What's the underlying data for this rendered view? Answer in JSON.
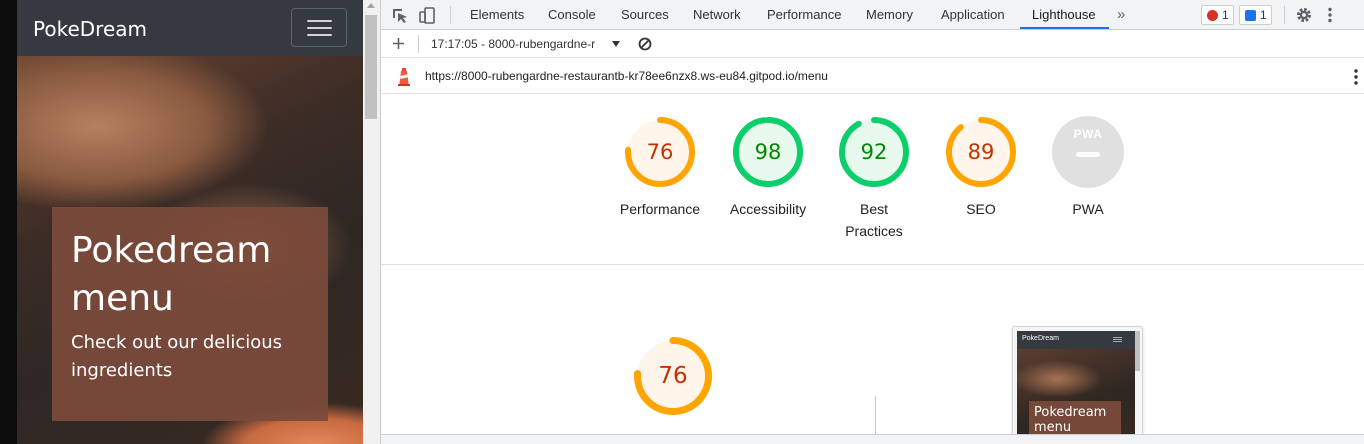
{
  "site": {
    "brand": "PokeDream",
    "hero_title": "Pokedream menu",
    "hero_subtitle": "Check out our delicious ingredients"
  },
  "devtools": {
    "tabs": [
      "Elements",
      "Console",
      "Sources",
      "Network",
      "Performance",
      "Memory",
      "Application",
      "Lighthouse"
    ],
    "active_tab": "Lighthouse",
    "more_tabs": "»",
    "error_count": "1",
    "message_count": "1",
    "report_selector": "17:17:05 - 8000-rubengardne-r",
    "url": "https://8000-rubengardne-restaurantb-kr78ee6nzx8.ws-eu84.gitpod.io/menu"
  },
  "scores": [
    {
      "label": "Performance",
      "value": "76",
      "fraction": 0.76,
      "status": "average"
    },
    {
      "label": "Accessibility",
      "value": "98",
      "fraction": 0.98,
      "status": "pass"
    },
    {
      "label": "Best Practices",
      "value": "92",
      "fraction": 0.92,
      "status": "pass"
    },
    {
      "label": "SEO",
      "value": "89",
      "fraction": 0.89,
      "status": "average"
    },
    {
      "label": "PWA",
      "value": "PWA",
      "fraction": 0,
      "status": "na"
    }
  ],
  "performance_detail": {
    "value": "76",
    "fraction": 0.76
  },
  "thumbnail": {
    "brand": "PokeDream",
    "title": "Pokedream menu"
  },
  "colors": {
    "pass": "#0cce6b",
    "pass_text": "#008800",
    "pass_fill": "#e7f9ed",
    "average": "#ffa400",
    "average_text": "#c33300",
    "average_fill": "#fff5eb",
    "na_fill": "#e0e0e0",
    "accent": "#1a73e8",
    "navbar": "#343a40",
    "hero_card": "#7a4a3a"
  },
  "icons": {
    "inspect": "inspect-element-icon",
    "device": "device-toolbar-icon",
    "settings": "gear-icon",
    "menu": "kebab-menu-icon",
    "lighthouse": "lighthouse-icon"
  }
}
